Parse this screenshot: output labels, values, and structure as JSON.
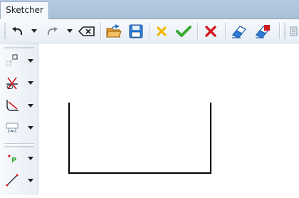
{
  "tabs": [
    {
      "label": "Sketcher",
      "active": true
    }
  ],
  "toolbar": {
    "buttons": [
      {
        "name": "undo-button",
        "icon": "undo-icon"
      },
      {
        "name": "undo-dropdown",
        "icon": "chevron-down-icon"
      },
      {
        "name": "redo-button",
        "icon": "redo-icon",
        "enabled": false
      },
      {
        "name": "redo-dropdown",
        "icon": "chevron-down-icon"
      },
      {
        "name": "clear-button",
        "icon": "backspace-icon"
      },
      {
        "name": "open-button",
        "icon": "folder-open-icon"
      },
      {
        "name": "save-button",
        "icon": "floppy-disk-icon"
      },
      {
        "name": "cancel-button",
        "icon": "yellow-x-icon"
      },
      {
        "name": "accept-button",
        "icon": "green-check-icon"
      },
      {
        "name": "delete-button",
        "icon": "red-x-icon"
      },
      {
        "name": "eraser-button",
        "icon": "eraser-icon"
      },
      {
        "name": "eraser-constraint-button",
        "icon": "eraser-constraint-icon"
      },
      {
        "name": "overflow-button",
        "icon": "overflow-icon"
      }
    ]
  },
  "sidebar": {
    "tools": [
      {
        "name": "select-tool",
        "icon": "select-icon"
      },
      {
        "name": "trim-tool",
        "icon": "trim-icon"
      },
      {
        "name": "fillet-tool",
        "icon": "fillet-icon"
      },
      {
        "name": "dimension-tool",
        "icon": "dimension-icon"
      },
      {
        "name": "point-tool",
        "icon": "point-icon"
      },
      {
        "name": "line-tool",
        "icon": "line-icon"
      }
    ]
  },
  "colors": {
    "accent_red": "#d0191f",
    "accent_green": "#3aa832",
    "accent_yellow": "#f2b705",
    "icon_blue": "#1f5fae",
    "sketch_line": "#000000"
  }
}
